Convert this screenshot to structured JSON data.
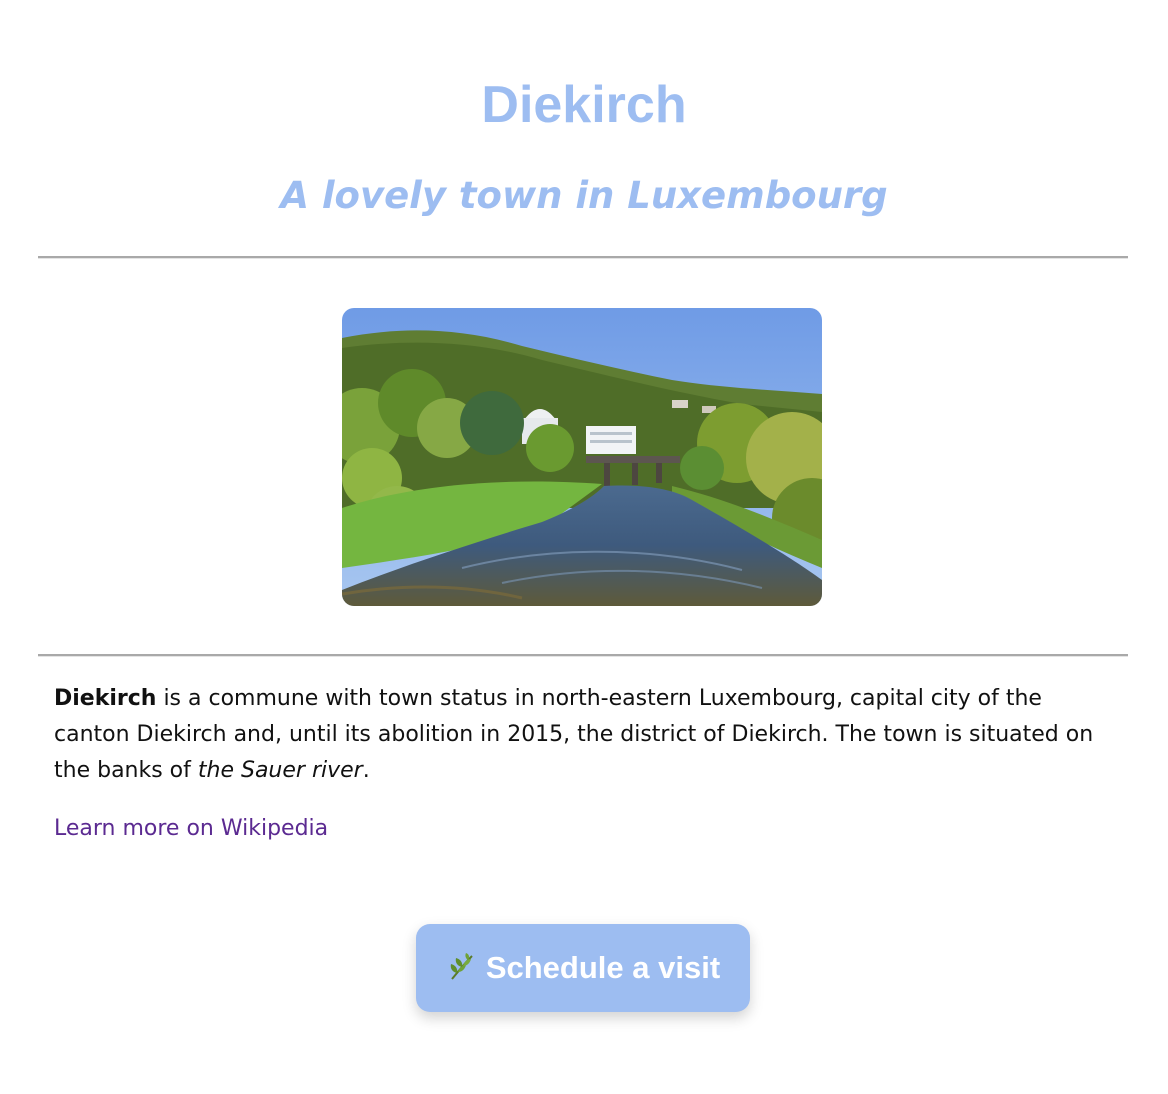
{
  "colors": {
    "accent": "#9dbdf1",
    "link": "#5b2a91",
    "rule": "#a9a9a9"
  },
  "header": {
    "title": "Diekirch",
    "subtitle": "A lovely town in Luxembourg"
  },
  "image": {
    "icon": "river-landscape-photo"
  },
  "description": {
    "town_name": "Diekirch",
    "text_part1": " is a commune with town status in north-eastern Luxembourg, capital city of the canton Diekirch and, until its abolition in 2015, the district of Diekirch. The town is situated on the banks of ",
    "river": "the Sauer river",
    "text_end": "."
  },
  "link": {
    "label": "Learn more on Wikipedia"
  },
  "cta": {
    "icon": "herb-leaf-icon",
    "label": "Schedule a visit"
  }
}
